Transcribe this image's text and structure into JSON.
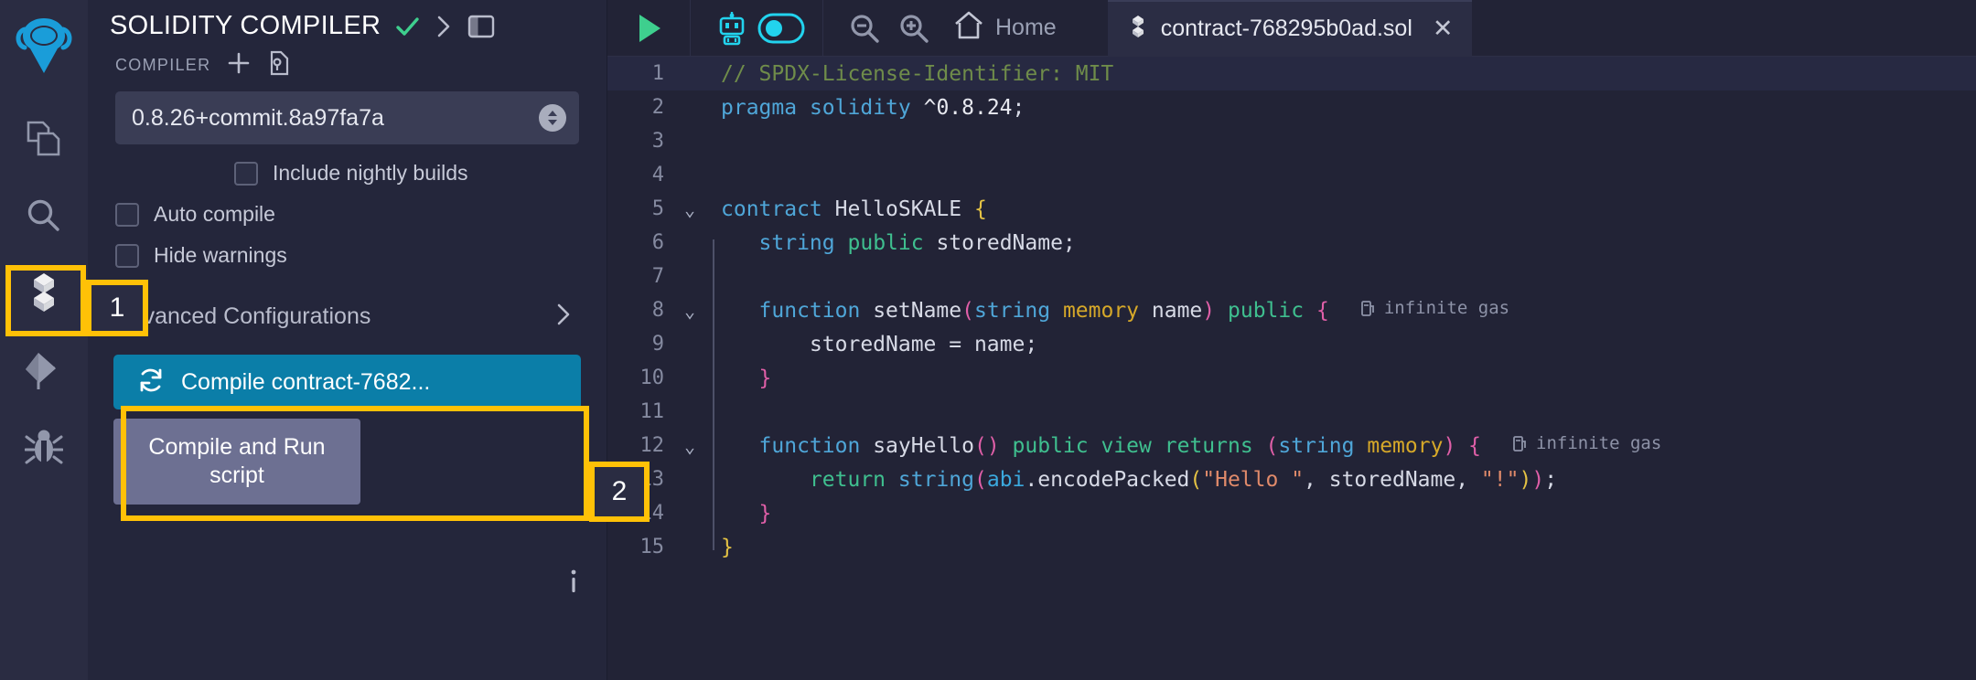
{
  "rail": {
    "logo_icon": "remix-logo-icon",
    "items": [
      {
        "icon": "file-explorer-icon",
        "name": "file-explorer"
      },
      {
        "icon": "search-icon",
        "name": "search"
      },
      {
        "icon": "solidity-compiler-icon",
        "name": "solidity-compiler",
        "active": true
      },
      {
        "icon": "deploy-run-icon",
        "name": "deploy-run"
      },
      {
        "icon": "debugger-icon",
        "name": "debugger"
      }
    ]
  },
  "panel": {
    "title": "SOLIDITY COMPILER",
    "check_icon": "green-check-icon",
    "chevron_icon": "chevron-right-icon",
    "layout_icon": "panel-layout-icon",
    "compiler_label": "COMPILER",
    "plus_icon": "plus-icon",
    "config_file_icon": "config-file-icon",
    "version": "0.8.26+commit.8a97fa7a",
    "nightly_label": "Include nightly builds",
    "auto_compile_label": "Auto compile",
    "hide_warnings_label": "Hide warnings",
    "advanced_label": "Advanced Configurations",
    "advanced_chevron": "chevron-right-icon",
    "compile_icon": "refresh-icon",
    "compile_label": "Compile contract-7682...",
    "run_script_label": "Compile and Run script",
    "info_icon": "info-icon",
    "copy_icon": "copy-icon"
  },
  "editor": {
    "run_icon": "play-icon",
    "ai_icon": "robot-icon",
    "toggle_icon": "toggle-on-icon",
    "zoom_out_icon": "zoom-out-icon",
    "zoom_in_icon": "zoom-in-icon",
    "home_icon": "home-icon",
    "home_label": "Home",
    "tab": {
      "file_icon": "solidity-file-icon",
      "label": "contract-768295b0ad.sol",
      "close_icon": "close-icon",
      "close_glyph": "✕"
    },
    "gas_label": "infinite gas",
    "gas_icon": "gas-icon",
    "lines": [
      {
        "n": "1",
        "fold": "",
        "bar": false
      },
      {
        "n": "2",
        "fold": "",
        "bar": false
      },
      {
        "n": "3",
        "fold": "",
        "bar": false
      },
      {
        "n": "4",
        "fold": "",
        "bar": false
      },
      {
        "n": "5",
        "fold": "⌄",
        "bar": false
      },
      {
        "n": "6",
        "fold": "",
        "bar": true
      },
      {
        "n": "7",
        "fold": "",
        "bar": true
      },
      {
        "n": "8",
        "fold": "⌄",
        "bar": true
      },
      {
        "n": "9",
        "fold": "",
        "bar": true
      },
      {
        "n": "10",
        "fold": "",
        "bar": true
      },
      {
        "n": "11",
        "fold": "",
        "bar": true
      },
      {
        "n": "12",
        "fold": "⌄",
        "bar": true
      },
      {
        "n": "13",
        "fold": "",
        "bar": true
      },
      {
        "n": "14",
        "fold": "",
        "bar": true
      },
      {
        "n": "15",
        "fold": "",
        "bar": false
      }
    ],
    "code": [
      "// SPDX-License-Identifier: MIT",
      "pragma solidity ^0.8.24;",
      "",
      "",
      "contract HelloSKALE {",
      "    string public storedName;",
      "",
      "    function setName(string memory name) public {",
      "        storedName = name;",
      "    }",
      "",
      "    function sayHello() public view returns (string memory) {",
      "        return string(abi.encodePacked(\"Hello \", storedName, \"!\"));",
      "    }",
      "}"
    ]
  },
  "annotations": [
    {
      "label": "1",
      "target": "solidity-compiler-rail-icon"
    },
    {
      "label": "2",
      "target": "compile-contract-button"
    }
  ],
  "colors": {
    "accent_yellow": "#ffc107",
    "compile_blue": "#0b7ea8",
    "panel_bg": "#24263b",
    "rail_bg": "#2a2c42",
    "editor_bg": "#222336",
    "logo_cyan": "#1a9dd9"
  }
}
